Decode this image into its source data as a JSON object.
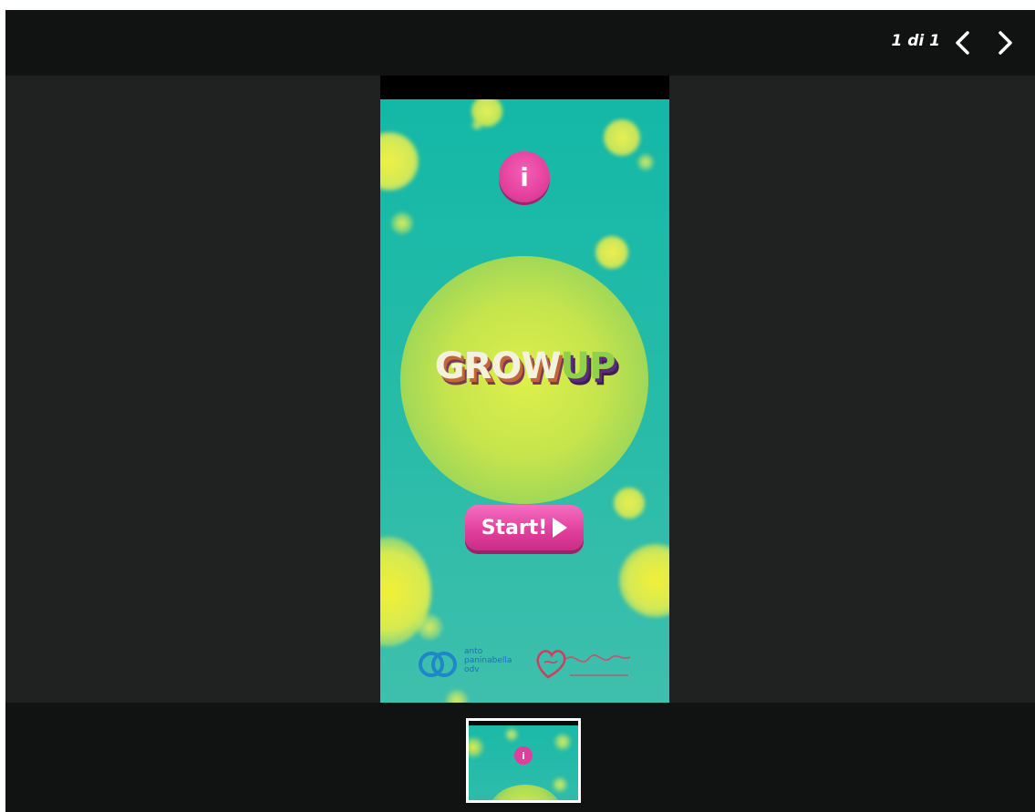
{
  "viewer": {
    "counter": "1 di 1",
    "prev_icon": "chevron-left-icon",
    "next_icon": "chevron-right-icon"
  },
  "slide": {
    "app_title_part1": "GROW",
    "app_title_part2": "UP",
    "info_label": "i",
    "start_label": "Start!",
    "sponsor_1": "anto\npaninabella\nodv",
    "colors": {
      "teal": "#14b8a7",
      "pink": "#e13d9c",
      "yellow": "#ddf04a",
      "green": "#8fd14a"
    }
  },
  "thumbnail": {
    "info_label": "i"
  }
}
